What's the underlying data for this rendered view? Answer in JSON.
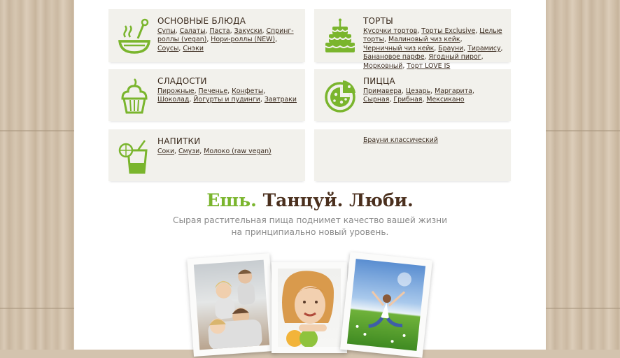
{
  "categories": {
    "main_dishes": {
      "title": "ОСНОВНЫЕ БЛЮДА",
      "links": [
        "Супы",
        "Салаты",
        "Паста",
        "Закуски",
        "Спринг-роллы (vegan)",
        "Нори-роллы (NEW)",
        "Соусы",
        "Снэки"
      ]
    },
    "cakes": {
      "title": "ТОРТЫ",
      "links": [
        "Кусочки тортов",
        "Торты Exclusive",
        "Целые торты",
        "Малиновый чиз кейк",
        "Черничный чиз кейк",
        "Брауни",
        "Тирамису",
        "Банановое парфе",
        "Ягодный пирог",
        "Морковный",
        "Торт LOVE IS"
      ]
    },
    "sweets": {
      "title": "СЛАДОСТИ",
      "links": [
        "Пирожные",
        "Печенье",
        "Конфеты",
        "Шоколад",
        "Йогурты и пудинги",
        "Завтраки"
      ]
    },
    "pizza": {
      "title": "ПИЦЦА",
      "links": [
        "Примавера",
        "Цезарь",
        "Маргарита",
        "Сырная",
        "Грибная",
        "Мексикано"
      ]
    },
    "drinks": {
      "title": "НАПИТКИ",
      "links": [
        "Соки",
        "Смузи",
        "Молоко (raw vegan)"
      ]
    },
    "extra": {
      "links": [
        "Брауни классический"
      ]
    }
  },
  "slogan": {
    "part1": "Ешь.",
    "part2": "Танцуй. Люби."
  },
  "subtitle": {
    "line1": "Сырая растительная пища поднимет качество вашей жизни",
    "line2": "на принципиально новый уровень."
  },
  "colors": {
    "accent": "#7ab52d",
    "brown": "#4a2f1d",
    "card_bg": "#f2f1ec",
    "gray_text": "#8a8a8a"
  },
  "icons": {
    "main_dishes": "soup-bowl-icon",
    "cakes": "layer-cake-icon",
    "sweets": "cupcake-icon",
    "pizza": "pizza-icon",
    "drinks": "juice-glass-icon"
  }
}
